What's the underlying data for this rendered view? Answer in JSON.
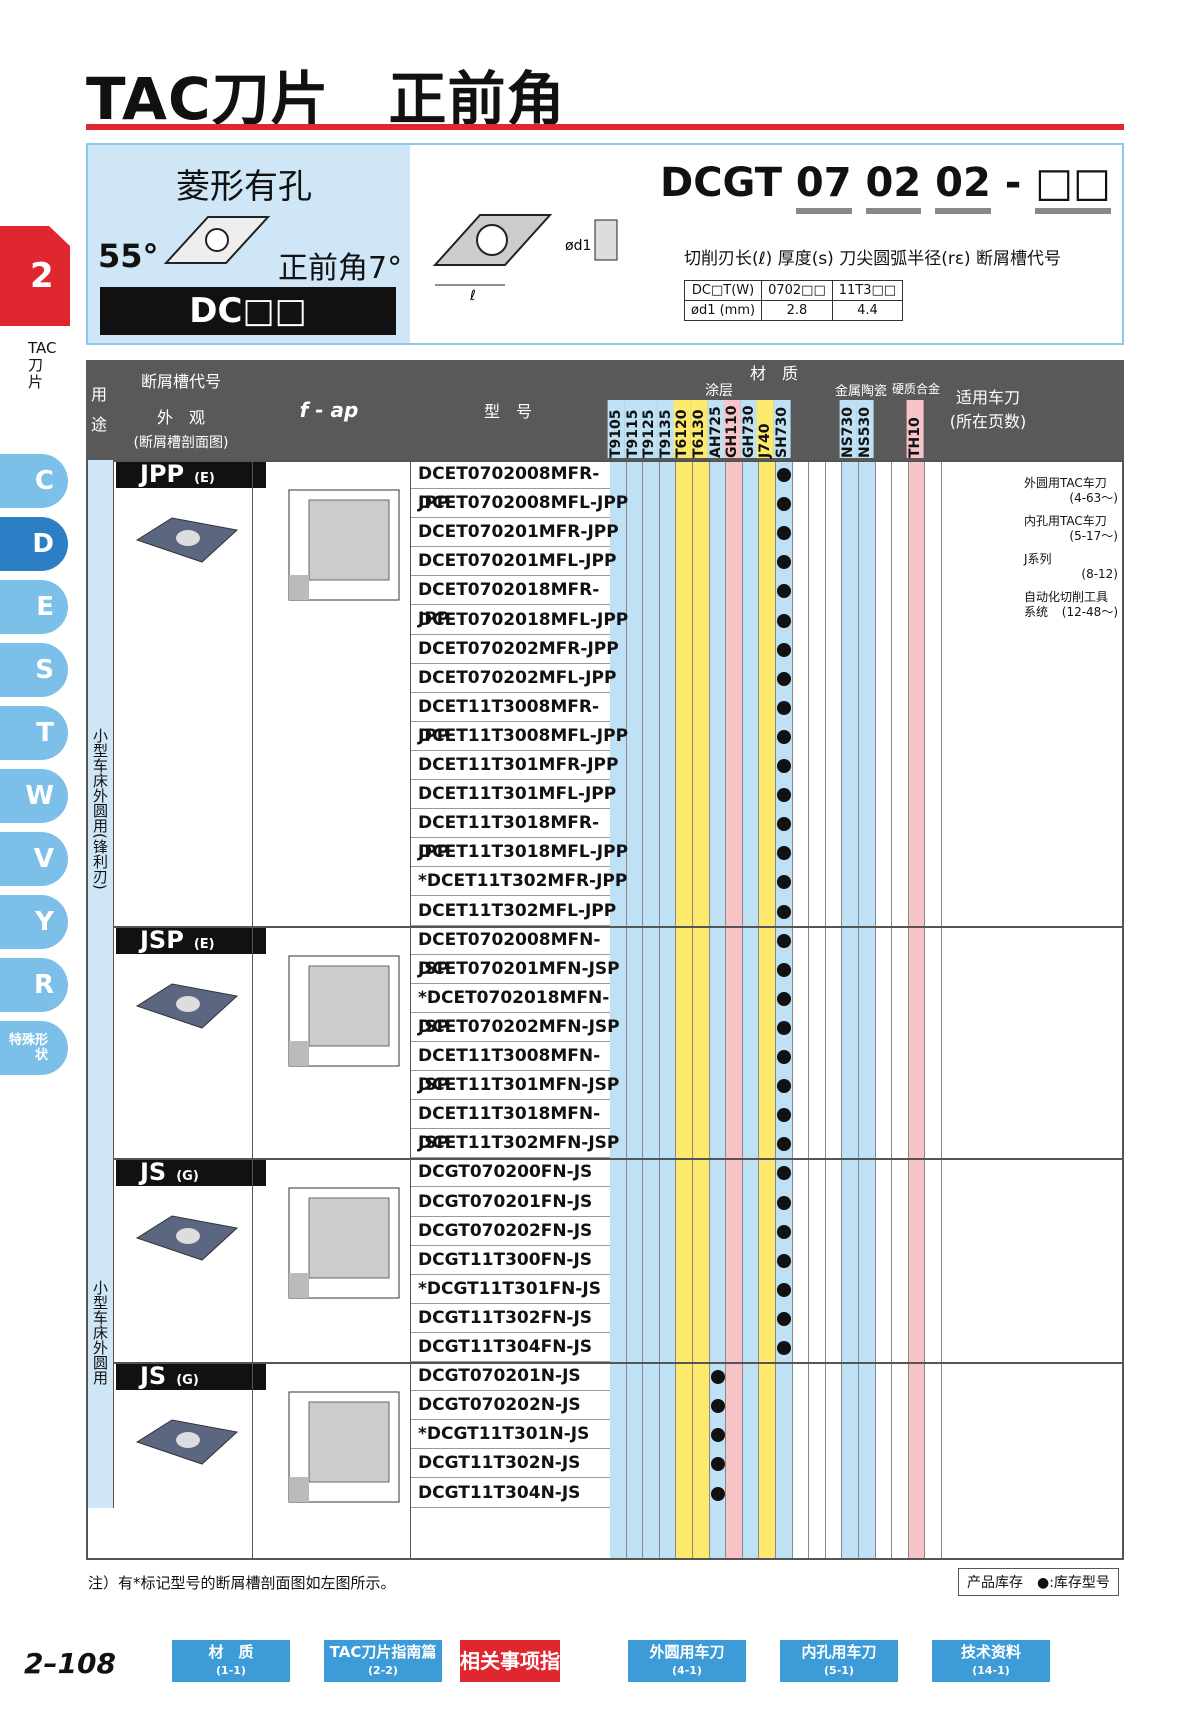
{
  "title": "TAC刀片　正前角",
  "header": {
    "shape": "菱形有孔",
    "angle": "55°",
    "rake": "正前角7°",
    "code_bar": "DC□□",
    "code_prefix": "DCGT",
    "code_parts": [
      "07",
      "02",
      "02",
      "-",
      "□□"
    ],
    "code_labels": "切削刃长(ℓ) 厚度(s) 刀尖圆弧半径(rε) 断屑槽代号",
    "dim_table": {
      "r1": [
        "DC□T(W)",
        "0702□□",
        "11T3□□"
      ],
      "r2": [
        "ød1 (mm)",
        "2.8",
        "4.4"
      ]
    }
  },
  "side": {
    "chapter": "2",
    "label": "TAC刀片",
    "tabs": [
      "C",
      "D",
      "E",
      "S",
      "T",
      "W",
      "V",
      "Y",
      "R",
      "特殊形状"
    ]
  },
  "table_head": {
    "use": "用途",
    "groove": "断屑槽代号",
    "look": "外　观",
    "profile": "(断屑槽剖面图)",
    "fap": "f - ap",
    "model": "型　号",
    "material": "材　质",
    "coating": "涂层",
    "cermet": "金属陶瓷",
    "carbide": "硬质合金",
    "holder": "适用车刀",
    "holder2": "(所在页数)",
    "grades": [
      "T9105",
      "T9115",
      "T9125",
      "T9135",
      "T6120",
      "T6130",
      "AH725",
      "GH110",
      "GH730",
      "J740",
      "SH730",
      "",
      "",
      "",
      "NS730",
      "NS530",
      "",
      "",
      "TH10",
      ""
    ]
  },
  "groups": [
    {
      "name": "JPP",
      "tag": "(E)"
    },
    {
      "name": "JSP",
      "tag": "(E)"
    },
    {
      "name": "JS",
      "tag": "(G)"
    },
    {
      "name": "JS",
      "tag": "(G)"
    }
  ],
  "use_labels": [
    "小型车床外圆用(锋利刃)",
    "小型车床外圆用"
  ],
  "models": [
    "DCET0702008MFR-JPP",
    "DCET0702008MFL-JPP",
    "DCET070201MFR-JPP",
    "DCET070201MFL-JPP",
    "DCET0702018MFR-JPP",
    "DCET0702018MFL-JPP",
    "DCET070202MFR-JPP",
    "DCET070202MFL-JPP",
    "DCET11T3008MFR-JPP",
    "DCET11T3008MFL-JPP",
    "DCET11T301MFR-JPP",
    "DCET11T301MFL-JPP",
    "DCET11T3018MFR-JPP",
    "DCET11T3018MFL-JPP",
    "*DCET11T302MFR-JPP",
    "DCET11T302MFL-JPP",
    "DCET0702008MFN-JSP",
    "DCET070201MFN-JSP",
    "*DCET0702018MFN-JSP",
    "DCET070202MFN-JSP",
    "DCET11T3008MFN-JSP",
    "DCET11T301MFN-JSP",
    "DCET11T3018MFN-JSP",
    "DCET11T302MFN-JSP",
    "DCGT070200FN-JS",
    "DCGT070201FN-JS",
    "DCGT070202FN-JS",
    "DCGT11T300FN-JS",
    "*DCGT11T301FN-JS",
    "DCGT11T302FN-JS",
    "DCGT11T304FN-JS",
    "DCGT070201N-JS",
    "DCGT070202N-JS",
    "*DCGT11T301N-JS",
    "DCGT11T302N-JS",
    "DCGT11T304N-JS"
  ],
  "apps": [
    "外圆用TAC车刀",
    "(4-63～)",
    "内孔用TAC车刀",
    "(5-17～)",
    "J系列",
    "(8-12)",
    "自动化切削工具系统",
    "(12-48～)"
  ],
  "note": "注）有*标记型号的断屑槽剖面图如左图所示。",
  "stock": "产品库存　●:库存型号",
  "page": "2–108",
  "nav": [
    {
      "a": "材　质",
      "b": "(1-1)"
    },
    {
      "a": "TAC刀片指南篇",
      "b": "(2-2)"
    },
    {
      "a": "相关事项指南",
      "b": ""
    },
    {
      "a": "外圆用车刀",
      "b": "(4-1)"
    },
    {
      "a": "内孔用车刀",
      "b": "(5-1)"
    },
    {
      "a": "技术资料",
      "b": "(14-1)"
    }
  ]
}
